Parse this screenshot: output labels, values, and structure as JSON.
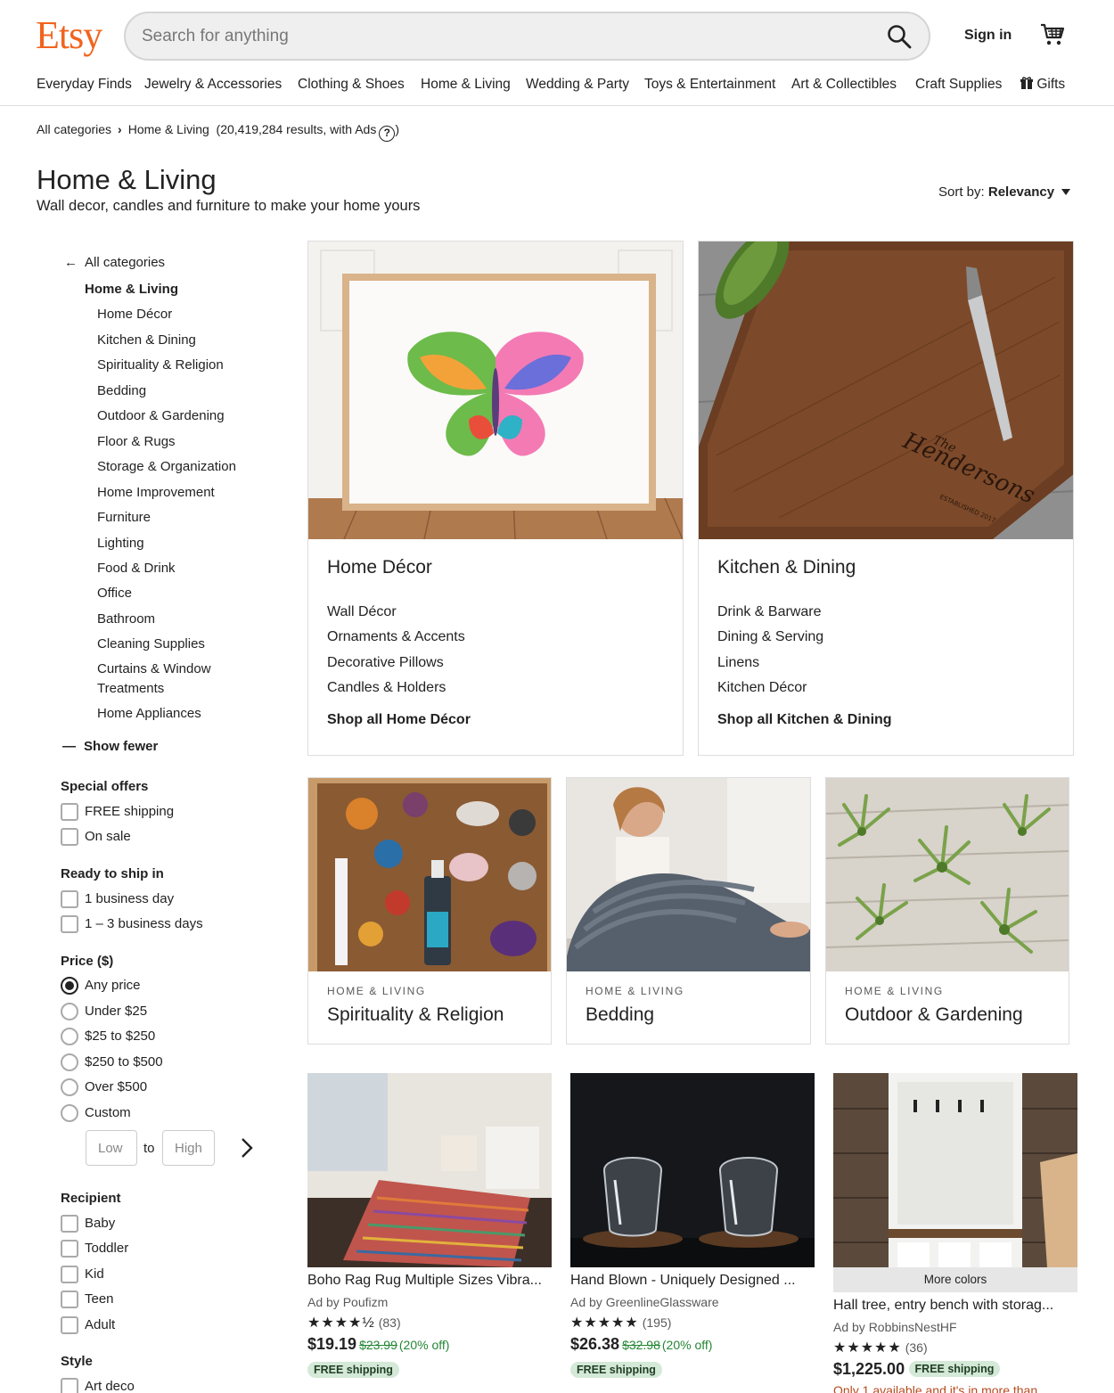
{
  "header": {
    "logo": "Etsy",
    "search_placeholder": "Search for anything",
    "sign_in": "Sign in"
  },
  "nav": [
    "Everyday Finds",
    "Jewelry & Accessories",
    "Clothing & Shoes",
    "Home & Living",
    "Wedding & Party",
    "Toys & Entertainment",
    "Art & Collectibles",
    "Craft Supplies",
    "Gifts"
  ],
  "breadcrumb": {
    "root": "All categories",
    "current": "Home & Living",
    "results": "(20,419,284 results, with Ads",
    "close_paren": ")"
  },
  "page": {
    "title": "Home & Living",
    "subtitle": "Wall decor, candles and furniture to make your home yours",
    "sort_label": "Sort by:",
    "sort_value": "Relevancy"
  },
  "sidebar": {
    "back": "All categories",
    "current": "Home & Living",
    "subcategories": [
      "Home Décor",
      "Kitchen & Dining",
      "Spirituality & Religion",
      "Bedding",
      "Outdoor & Gardening",
      "Floor & Rugs",
      "Storage & Organization",
      "Home Improvement",
      "Furniture",
      "Lighting",
      "Food & Drink",
      "Office",
      "Bathroom",
      "Cleaning Supplies",
      "Curtains & Window",
      "Treatments",
      "Home Appliances"
    ],
    "show_fewer": "Show fewer",
    "special_offers": {
      "title": "Special offers",
      "options": [
        "FREE shipping",
        "On sale"
      ]
    },
    "ready_to_ship": {
      "title": "Ready to ship in",
      "options": [
        "1 business day",
        "1 – 3 business days"
      ]
    },
    "price": {
      "title": "Price ($)",
      "options": [
        "Any price",
        "Under $25",
        "$25 to $250",
        "$250 to $500",
        "Over $500",
        "Custom"
      ],
      "selected": "Any price",
      "low_placeholder": "Low",
      "to": "to",
      "high_placeholder": "High"
    },
    "recipient": {
      "title": "Recipient",
      "options": [
        "Baby",
        "Toddler",
        "Kid",
        "Teen",
        "Adult"
      ]
    },
    "style": {
      "title": "Style",
      "options": [
        "Art deco"
      ]
    }
  },
  "featured": [
    {
      "title": "Home Décor",
      "links": [
        "Wall Décor",
        "Ornaments & Accents",
        "Decorative Pillows",
        "Candles & Holders"
      ],
      "shop_all": "Shop all Home Décor"
    },
    {
      "title": "Kitchen & Dining",
      "links": [
        "Drink & Barware",
        "Dining & Serving",
        "Linens",
        "Kitchen Décor"
      ],
      "shop_all": "Shop all Kitchen & Dining",
      "engraving": [
        "The",
        "Hendersons",
        "ESTABLISHED 2017"
      ]
    }
  ],
  "tiles": [
    {
      "kicker": "HOME & LIVING",
      "title": "Spirituality & Religion"
    },
    {
      "kicker": "HOME & LIVING",
      "title": "Bedding"
    },
    {
      "kicker": "HOME & LIVING",
      "title": "Outdoor & Gardening"
    }
  ],
  "listings": [
    {
      "title": "Boho Rag Rug Multiple Sizes Vibra...",
      "ad": "Ad by Poufizm",
      "stars": "★★★★½",
      "count": "(83)",
      "price": "$19.19",
      "was": "$23.99",
      "off": "(20% off)",
      "badge": "FREE shipping"
    },
    {
      "title": "Hand Blown - Uniquely Designed ...",
      "ad": "Ad by GreenlineGlassware",
      "stars": "★★★★★",
      "count": "(195)",
      "price": "$26.38",
      "was": "$32.98",
      "off": "(20% off)",
      "badge": "FREE shipping"
    },
    {
      "title": "Hall tree, entry bench with storag...",
      "ad": "Ad by RobbinsNestHF",
      "stars": "★★★★★",
      "count": "(36)",
      "price": "$1,225.00",
      "badge": "FREE shipping",
      "more_colors": "More colors",
      "warning": "Only 1 available and it's in more than"
    }
  ],
  "colors": {
    "brand": "#f1641e",
    "sale_green": "#258635",
    "badge_bg": "#d4e9d7"
  }
}
